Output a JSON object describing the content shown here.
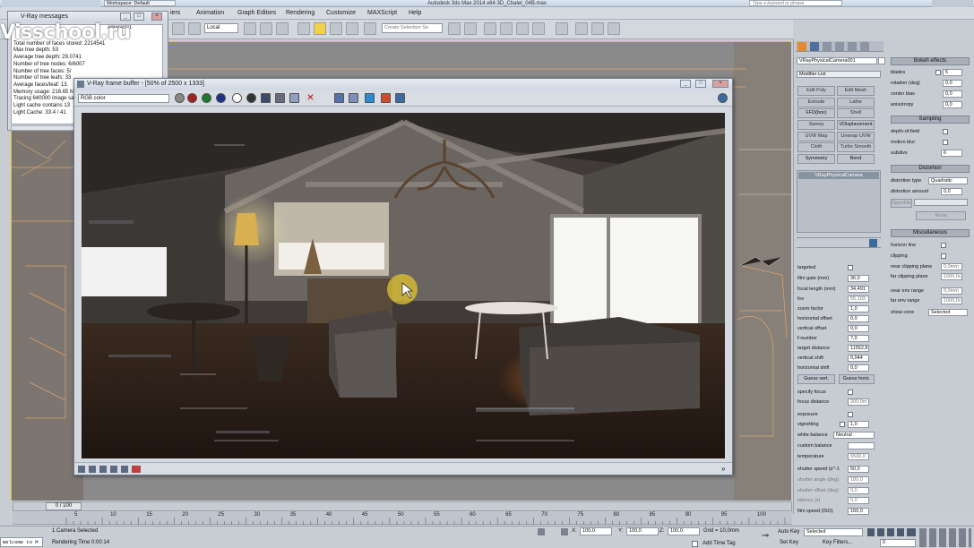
{
  "app": {
    "title": "Autodesk 3ds Max 2014 x64    3D_Chalet_04B.max",
    "workspace": "Workspace: Default",
    "search_placeholder": "Type a keyword or phrase"
  },
  "menu": [
    "iers",
    "Animation",
    "Graph Editors",
    "Rendering",
    "Customize",
    "MAXScript",
    "Help"
  ],
  "toolbar": {
    "coord_system": "Local",
    "selection_set": "Create Selection Se"
  },
  "watermark": "Visschool.ru",
  "vray_messages": {
    "title": "V-Ray messages",
    "camera": "amera001",
    "lines": [
      "Total number of faces stored: 2214541",
      "Max tree depth: 53",
      "Average tree depth: 29.0741",
      "Number of tree nodes: 6/6007",
      "Number of tree faces: 5/",
      "Number of tree leafs: 33",
      "Average faces/leaf: 13.",
      "Memory usage: 216.65 M",
      "Tracing 640000 image sa",
      "Light cache contains 13",
      "Light Cache: 33.4 / 41"
    ]
  },
  "frame_buffer": {
    "title": "V-Ray frame buffer - [50% of 2500 x 1333]",
    "channel": "RGB color"
  },
  "command_panel": {
    "object_name": "VRayPhysicalCamera001",
    "modifier_list": "Modifier List",
    "modifier_buttons": [
      "Edit Poly",
      "Edit Mesh",
      "Extrude",
      "Lathe",
      "FFD(box)",
      "Shell",
      "Sweep",
      "VDisplacement",
      "UVW Map",
      "Unwrap UVW",
      "Cloth",
      "Turbo Smooth",
      "Symmetry",
      "Bend"
    ],
    "stack_item": "VRayPhysicalCamera",
    "params": [
      {
        "label": "targeted",
        "value": ""
      },
      {
        "label": "film gate (mm)",
        "value": "36,0"
      },
      {
        "label": "focal length (mm)",
        "value": "34,491"
      },
      {
        "label": "fov",
        "value": "55,103"
      },
      {
        "label": "zoom factor",
        "value": "1,0"
      },
      {
        "label": "horizontal offset",
        "value": "0,0"
      },
      {
        "label": "vertical offset",
        "value": "0,0"
      },
      {
        "label": "f-number",
        "value": "7,0"
      },
      {
        "label": "target distance",
        "value": "11552,8"
      },
      {
        "label": "vertical shift",
        "value": "0,044"
      },
      {
        "label": "horizontal shift",
        "value": "0,0"
      }
    ],
    "guess_vert": "Guess vert.",
    "guess_horiz": "Guess horiz.",
    "params2": [
      {
        "label": "specify focus",
        "value": ""
      },
      {
        "label": "focus distance",
        "value": "200,0m"
      },
      {
        "label": "exposure",
        "value": ""
      },
      {
        "label": "vignetting",
        "value": "1,0"
      },
      {
        "label": "white balance",
        "value": "Neutral"
      },
      {
        "label": "custom balance",
        "value": ""
      },
      {
        "label": "temperature",
        "value": "6500,0"
      },
      {
        "label": "shutter speed (s^-1",
        "value": "50,0"
      },
      {
        "label": "shutter angle (deg)",
        "value": "180,0"
      },
      {
        "label": "shutter offset (deg)",
        "value": "0,0"
      },
      {
        "label": "latency (s)",
        "value": "0,0"
      },
      {
        "label": "film speed (ISO)",
        "value": "160,0"
      }
    ],
    "bokeh": {
      "title": "Bokeh effects",
      "rows": [
        {
          "label": "blades",
          "value": "5"
        },
        {
          "label": "rotation (deg)",
          "value": "0,0"
        },
        {
          "label": "center bias",
          "value": "0,0"
        },
        {
          "label": "anisotropy",
          "value": "0,0"
        }
      ]
    },
    "sampling": {
      "title": "Sampling",
      "dof": "depth-of-field",
      "motion_blur": "motion blur",
      "subdivs_label": "subdivs",
      "subdivs": "6"
    },
    "distortion": {
      "title": "Distortion",
      "type_label": "distortion type",
      "type": "Quadratic",
      "amount_label": "distortion amount",
      "amount": "0,0",
      "file_label": "OpenFile",
      "none": "None"
    },
    "misc": {
      "title": "Miscellaneous",
      "horizon": "horizon line",
      "clipping": "clipping",
      "near_clip_label": "near clipping plane",
      "near_clip": "0,0mm",
      "far_clip_label": "far clipping plane",
      "far_clip": "1000,0c",
      "near_env_label": "near env range",
      "near_env": "0,0mm",
      "far_env_label": "far env range",
      "far_env": "1000,0c",
      "show_cone_label": "show cone",
      "show_cone": "Selected"
    }
  },
  "timeline": {
    "frame": "0 / 100",
    "ticks": [
      "5",
      "10",
      "15",
      "20",
      "25",
      "30",
      "35",
      "40",
      "45",
      "50",
      "55",
      "60",
      "65",
      "70",
      "75",
      "80",
      "85",
      "90",
      "95",
      "100"
    ]
  },
  "status": {
    "welcome": "Welcome to M",
    "selection": "1 Camera Selected",
    "render_time": "Rendering Time 0:00:14",
    "x": "100,0",
    "y": "100,0",
    "z": "100,0",
    "grid": "Grid = 10,0mm",
    "auto_key": "Auto Key",
    "selected": "Selected",
    "set_key": "Set Key",
    "key_filters": "Key Filters...",
    "add_time_tag": "Add Time Tag",
    "frame_field": "0"
  }
}
